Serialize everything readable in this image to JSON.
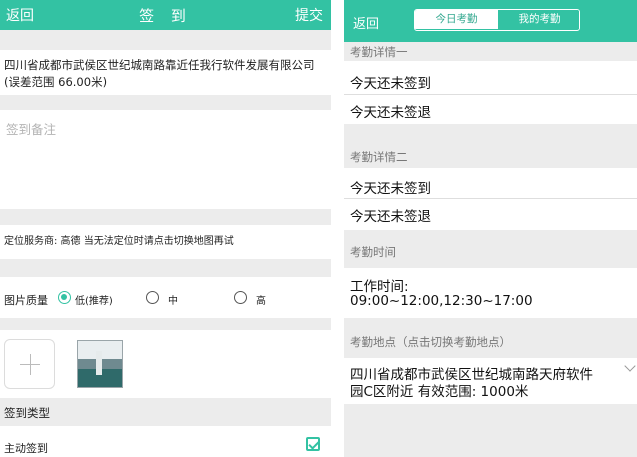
{
  "left": {
    "header": {
      "back": "返回",
      "title": "签 到",
      "submit": "提交"
    },
    "address": "四川省成都市武侯区世纪城南路靠近任我行软件发展有限公司(误差范围 66.00米)",
    "memo_placeholder": "签到备注",
    "location_service": "定位服务商:   高德   当无法定位时请点击切换地图再试",
    "image_quality": {
      "label": "图片质量",
      "options": [
        "低(推荐)",
        "中",
        "高"
      ],
      "selected": "低(推荐)"
    },
    "sign_type_header": "签到类型",
    "sign_type_option": "主动签到",
    "sign_type_checked": true
  },
  "right": {
    "header": {
      "back": "返回",
      "tabs": [
        "今日考勤",
        "我的考勤"
      ],
      "active_tab": "今日考勤"
    },
    "detail1": {
      "title": "考勤详情一",
      "checkin": "今天还未签到",
      "checkout": "今天还未签退"
    },
    "detail2": {
      "title": "考勤详情二",
      "checkin": "今天还未签到",
      "checkout": "今天还未签退"
    },
    "work_time": {
      "title": "考勤时间",
      "label": "工作时间:",
      "value": "09:00~12:00,12:30~17:00"
    },
    "location": {
      "title": "考勤地点（点击切换考勤地点）",
      "line1": "四川省成都市武侯区世纪城南路天府软件",
      "line2": "园C区附近 有效范围: 1000米"
    }
  },
  "colors": {
    "accent": "#33c2a3",
    "strip": "#ececec"
  }
}
